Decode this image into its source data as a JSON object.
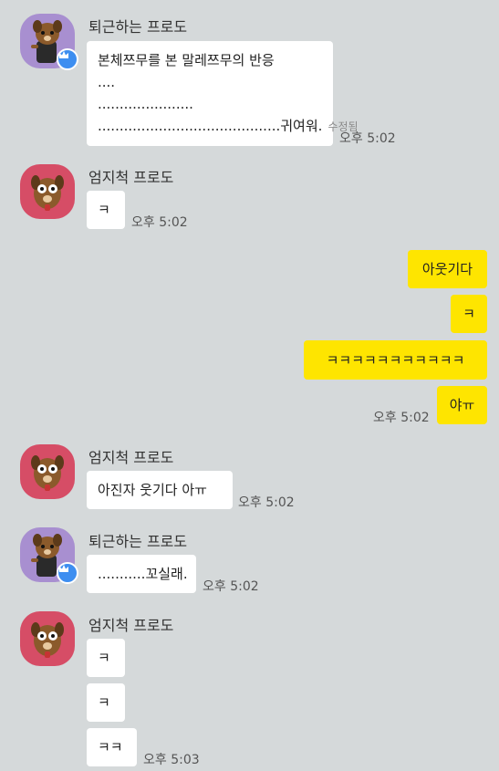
{
  "senders": {
    "frodo_off": "퇴근하는 프로도",
    "frodo_thumb": "엄지척 프로도"
  },
  "messages": {
    "m1": {
      "lines": [
        "본체쯔무를 본 말레쯔무의 반응",
        "....",
        "......................",
        "..........................................귀여워."
      ],
      "edited": "수정됨",
      "time": "오후 5:02"
    },
    "m2": {
      "text": "ㅋ",
      "time": "오후 5:02"
    },
    "m3": {
      "text": "아웃기다"
    },
    "m4": {
      "text": "ㅋ"
    },
    "m5": {
      "text": "ㅋㅋㅋㅋㅋㅋㅋㅋㅋㅋㅋ"
    },
    "m6": {
      "text": "야ㅠ",
      "time": "오후 5:02"
    },
    "m7": {
      "text": "아진자 웃기다 아ㅠ",
      "time": "오후 5:02"
    },
    "m8": {
      "text": "...........꼬실래.",
      "time": "오후 5:02"
    },
    "m9": {
      "text": "ㅋ"
    },
    "m10": {
      "text": "ㅋ"
    },
    "m11": {
      "text": "ㅋㅋ",
      "time": "오후 5:03"
    }
  },
  "colors": {
    "background": "#d5d9da",
    "my_bubble": "#fee500",
    "other_bubble": "#ffffff",
    "frodo_off_avatar": "#a88fd0",
    "frodo_thumb_avatar": "#d64d66",
    "badge": "#3d8ef0"
  },
  "icons": {
    "frodo_off_avatar": "frodo-avatar-icon",
    "frodo_thumb_avatar": "frodo-avatar-icon",
    "badge": "crown-icon"
  }
}
